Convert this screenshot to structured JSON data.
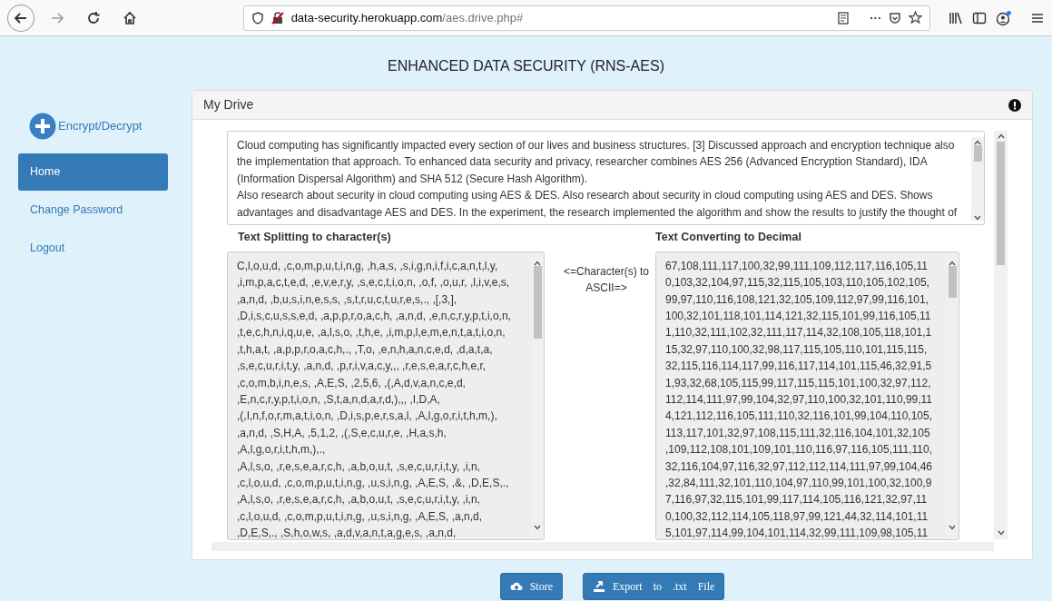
{
  "browser": {
    "url_host": "data-security.herokuapp.com",
    "url_path": "/aes.drive.php#",
    "more": "···"
  },
  "app_title": "ENHANCED DATA SECURITY (RNS-AES)",
  "sidebar": {
    "action": "Encrypt/Decrypt",
    "items": [
      {
        "label": "Home",
        "selected": true
      },
      {
        "label": "Change Password",
        "selected": false
      },
      {
        "label": "Logout",
        "selected": false
      }
    ]
  },
  "panel": {
    "title": "My Drive",
    "input_text": "Cloud computing has significantly impacted every section of our lives and business structures. [3] Discussed approach and encryption technique also\nthe implementation that approach. To enhanced data security and privacy, researcher combines AES 256 (Advanced Encryption Standard), IDA\n(Information Dispersal Algorithm) and SHA 512 (Secure Hash Algorithm).\nAlso research about security in cloud computing using AES & DES. Also research about security in cloud computing using AES and DES. Shows\nadvantages and disadvantage AES and DES. In the experiment, the research implemented the algorithm and show the results to justify the thought of",
    "split": {
      "heading": "Text Splitting to character(s)",
      "text": "C,l,o,u,d, ,c,o,m,p,u,t,i,n,g, ,h,a,s, ,s,i,g,n,i,f,i,c,a,n,t,l,y,\n,i,m,p,a,c,t,e,d, ,e,v,e,r,y, ,s,e,c,t,i,o,n, ,o,f, ,o,u,r, ,l,i,v,e,s,\n,a,n,d, ,b,u,s,i,n,e,s,s, ,s,t,r,u,c,t,u,r,e,s,., ,[,3,],\n,D,i,s,c,u,s,s,e,d, ,a,p,p,r,o,a,c,h, ,a,n,d, ,e,n,c,r,y,p,t,i,o,n,\n,t,e,c,h,n,i,q,u,e, ,a,l,s,o, ,t,h,e, ,i,m,p,l,e,m,e,n,t,a,t,i,o,n,\n,t,h,a,t, ,a,p,p,r,o,a,c,h,., ,T,o, ,e,n,h,a,n,c,e,d, ,d,a,t,a,\n,s,e,c,u,r,i,t,y, ,a,n,d, ,p,r,i,v,a,c,y,,, ,r,e,s,e,a,r,c,h,e,r,\n,c,o,m,b,i,n,e,s, ,A,E,S, ,2,5,6, ,(,A,d,v,a,n,c,e,d,\n,E,n,c,r,y,p,t,i,o,n, ,S,t,a,n,d,a,r,d,),,, ,I,D,A,\n,(,I,n,f,o,r,m,a,t,i,o,n, ,D,i,s,p,e,r,s,a,l, ,A,l,g,o,r,i,t,h,m,),\n,a,n,d, ,S,H,A, ,5,1,2, ,(,S,e,c,u,r,e, ,H,a,s,h,\n,A,l,g,o,r,i,t,h,m,),.,\n,A,l,s,o, ,r,e,s,e,a,r,c,h, ,a,b,o,u,t, ,s,e,c,u,r,i,t,y, ,i,n,\n,c,l,o,u,d, ,c,o,m,p,u,t,i,n,g, ,u,s,i,n,g, ,A,E,S, ,&, ,D,E,S,.,\n,A,l,s,o, ,r,e,s,e,a,r,c,h, ,a,b,o,u,t, ,s,e,c,u,r,i,t,y, ,i,n,\n,c,l,o,u,d, ,c,o,m,p,u,t,i,n,g, ,u,s,i,n,g, ,A,E,S, ,a,n,d,\n,D,E,S,., ,S,h,o,w,s, ,a,d,v,a,n,t,a,g,e,s, ,a,n,d,"
    },
    "arrow_label": "<=Character(s) to\nASCII=>",
    "decimal": {
      "heading": "Text Converting to Decimal",
      "text": "67,108,111,117,100,32,99,111,109,112,117,116,105,11\n0,103,32,104,97,115,32,115,105,103,110,105,102,105,\n99,97,110,116,108,121,32,105,109,112,97,99,116,101,\n100,32,101,118,101,114,121,32,115,101,99,116,105,11\n1,110,32,111,102,32,111,117,114,32,108,105,118,101,1\n15,32,97,110,100,32,98,117,115,105,110,101,115,115,\n32,115,116,114,117,99,116,117,114,101,115,46,32,91,5\n1,93,32,68,105,115,99,117,115,115,101,100,32,97,112,\n112,114,111,97,99,104,32,97,110,100,32,101,110,99,11\n4,121,112,116,105,111,110,32,116,101,99,104,110,105,\n113,117,101,32,97,108,115,111,32,116,104,101,32,105\n,109,112,108,101,109,101,110,116,97,116,105,111,110,\n32,116,104,97,116,32,97,112,112,114,111,97,99,104,46\n,32,84,111,32,101,110,104,97,110,99,101,100,32,100,9\n7,116,97,32,115,101,99,117,114,105,116,121,32,97,11\n0,100,32,112,114,105,118,97,99,121,44,32,114,101,11\n5,101,97,114,99,104,101,114,32,99,111,109,98,105,11"
    }
  },
  "buttons": [
    {
      "label": "Store",
      "kind": "store"
    },
    {
      "label": "Export to .txt File",
      "kind": "export"
    }
  ]
}
